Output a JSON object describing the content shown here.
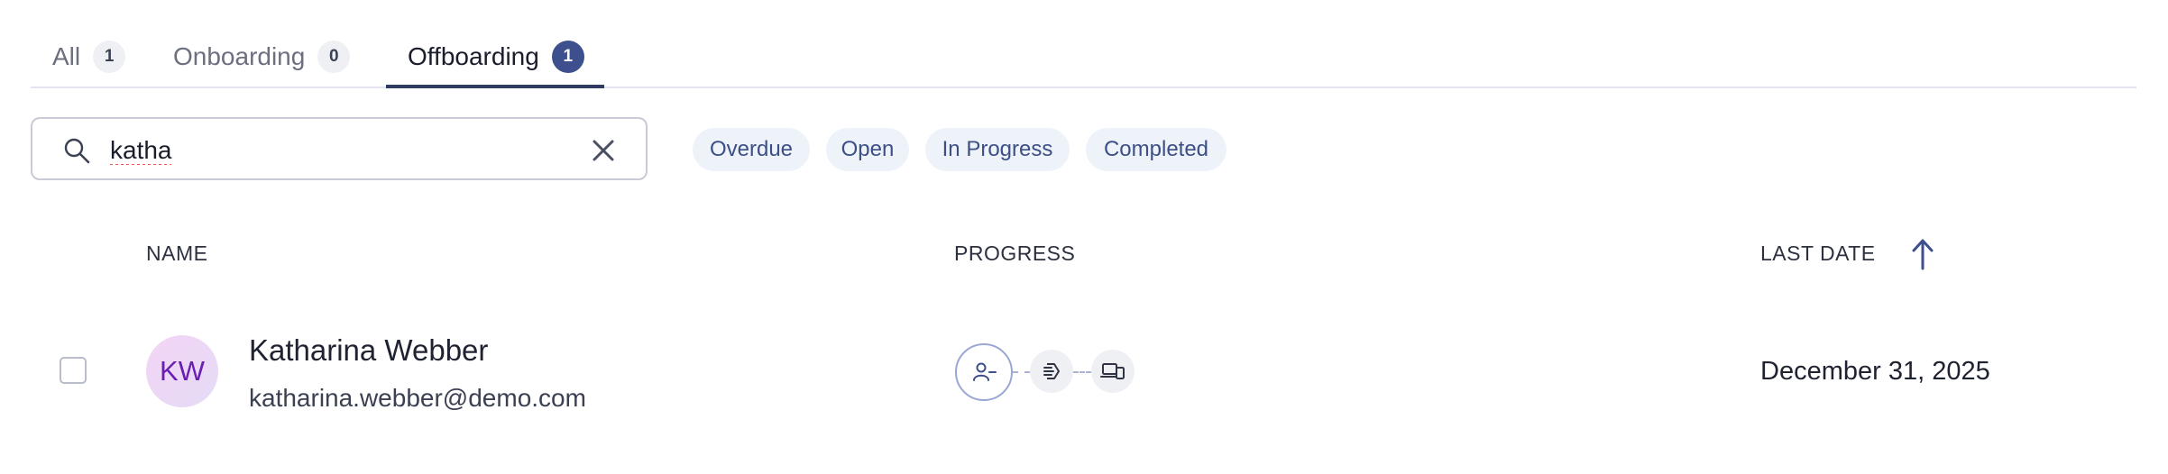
{
  "tabs": [
    {
      "label": "All",
      "count": "1",
      "active": false
    },
    {
      "label": "Onboarding",
      "count": "0",
      "active": false
    },
    {
      "label": "Offboarding",
      "count": "1",
      "active": true
    }
  ],
  "search": {
    "value": "katha",
    "icon": "search-icon",
    "clear_icon": "close-icon"
  },
  "filters": [
    "Overdue",
    "Open",
    "In Progress",
    "Completed"
  ],
  "table": {
    "columns": {
      "name": "NAME",
      "progress": "PROGRESS",
      "last_date": "LAST DATE"
    },
    "sort": {
      "column": "LAST DATE",
      "direction": "ascending",
      "icon": "arrow-up-icon"
    },
    "rows": [
      {
        "initials": "KW",
        "name": "Katharina Webber",
        "email": "katharina.webber@demo.com",
        "progress_steps": [
          "user-minus-icon",
          "access-icon",
          "devices-icon"
        ],
        "last_date": "December 31, 2025"
      }
    ]
  },
  "colors": {
    "accent": "#2f3b63",
    "badge_active": "#3d4f8c",
    "chip_bg": "#eef2f9",
    "chip_text": "#3c4f86",
    "avatar_text": "#6a1fb0"
  }
}
